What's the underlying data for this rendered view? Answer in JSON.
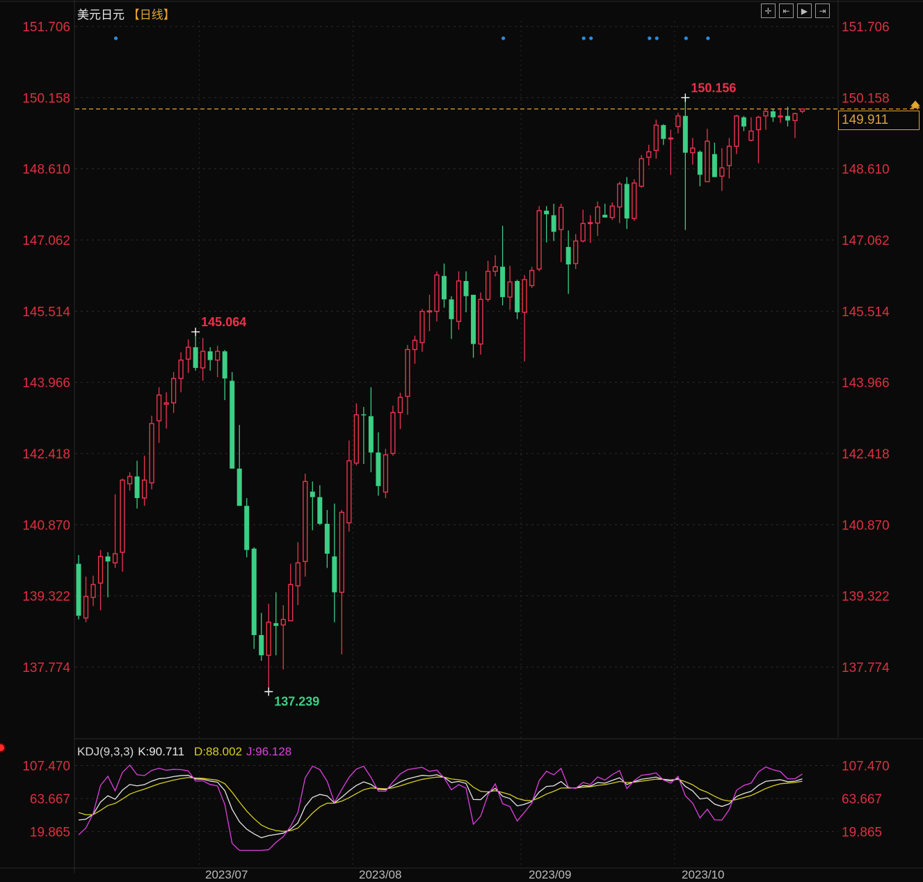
{
  "header": {
    "symbol": "美元日元",
    "period": "【日线】"
  },
  "toolbar": {
    "buttons": [
      {
        "name": "crosshair-button",
        "glyph": "✛"
      },
      {
        "name": "zoom-start-button",
        "glyph": "⇤"
      },
      {
        "name": "play-button",
        "glyph": "▶"
      },
      {
        "name": "jump-end-button",
        "glyph": "⇥"
      }
    ]
  },
  "current_price": "149.911",
  "indicator": {
    "name": "KDJ(9,3,3)",
    "k_label": "K:90.711",
    "d_label": "D:88.002",
    "j_label": "J:96.128"
  },
  "dates": [
    "2023/07",
    "2023/08",
    "2023/09",
    "2023/10"
  ],
  "colors": {
    "up": "#ee3550",
    "down": "#3ccf85",
    "axis_text": "#dd3040",
    "price_line": "#e6a532",
    "k": "#e8e8e8",
    "d": "#d8d020",
    "j": "#e040e0",
    "marker": "#2a8ae0"
  },
  "chart_data": {
    "type": "candlestick",
    "title": "美元日元 【日线】",
    "price_axis_labels": [
      "151.706",
      "150.158",
      "148.610",
      "147.062",
      "145.514",
      "143.966",
      "142.418",
      "140.870",
      "139.322",
      "137.774"
    ],
    "ylim": [
      136.9,
      151.706
    ],
    "high_label": "145.064",
    "high2_label": "150.156",
    "low_label": "137.239",
    "high_index": 16,
    "high2_index": 83,
    "low_index": 26,
    "last_price": 149.911,
    "event_marker_indices": [
      5,
      58,
      69,
      70,
      78,
      79,
      83,
      86
    ],
    "month_start_indices": [
      17,
      38,
      61,
      82
    ],
    "ohlc": [
      [
        140.02,
        140.21,
        138.81,
        138.89
      ],
      [
        138.84,
        139.74,
        138.75,
        139.31
      ],
      [
        139.29,
        139.76,
        139.1,
        139.57
      ],
      [
        139.6,
        140.32,
        139.01,
        140.18
      ],
      [
        140.18,
        140.27,
        139.29,
        140.07
      ],
      [
        140.04,
        141.53,
        139.93,
        140.24
      ],
      [
        140.27,
        141.87,
        139.85,
        141.84
      ],
      [
        141.76,
        142.01,
        141.61,
        141.92
      ],
      [
        141.92,
        142.26,
        141.22,
        141.45
      ],
      [
        141.45,
        142.37,
        141.28,
        141.84
      ],
      [
        141.78,
        143.24,
        141.64,
        143.07
      ],
      [
        143.13,
        143.86,
        142.65,
        143.69
      ],
      [
        143.49,
        143.75,
        142.96,
        143.52
      ],
      [
        143.52,
        144.19,
        143.3,
        144.05
      ],
      [
        144.05,
        144.62,
        143.75,
        144.45
      ],
      [
        144.47,
        144.9,
        144.17,
        144.73
      ],
      [
        144.73,
        145.064,
        144.22,
        144.28
      ],
      [
        144.28,
        144.93,
        144.0,
        144.64
      ],
      [
        144.64,
        144.73,
        144.22,
        144.45
      ],
      [
        144.45,
        144.76,
        144.08,
        144.64
      ],
      [
        144.64,
        144.67,
        143.58,
        144.05
      ],
      [
        144.0,
        144.19,
        142.09,
        142.09
      ],
      [
        142.09,
        143.04,
        141.28,
        141.28
      ],
      [
        141.28,
        141.45,
        140.16,
        140.32
      ],
      [
        140.35,
        140.38,
        138.17,
        138.47
      ],
      [
        138.47,
        138.95,
        137.91,
        138.03
      ],
      [
        138.03,
        139.15,
        137.239,
        138.75
      ],
      [
        138.73,
        139.4,
        138.03,
        138.67
      ],
      [
        138.69,
        139.12,
        137.72,
        138.81
      ],
      [
        138.78,
        140.02,
        138.78,
        139.57
      ],
      [
        139.54,
        140.49,
        139.12,
        140.04
      ],
      [
        140.07,
        141.98,
        139.74,
        141.81
      ],
      [
        141.59,
        141.81,
        140.75,
        141.47
      ],
      [
        141.47,
        141.73,
        140.86,
        140.89
      ],
      [
        140.89,
        141.19,
        139.93,
        140.24
      ],
      [
        140.18,
        141.33,
        138.75,
        139.4
      ],
      [
        139.4,
        141.19,
        138.05,
        141.14
      ],
      [
        140.91,
        142.7,
        140.72,
        142.26
      ],
      [
        142.21,
        143.51,
        142.16,
        143.26
      ],
      [
        143.27,
        143.43,
        142.19,
        143.25
      ],
      [
        143.23,
        143.86,
        142.01,
        142.44
      ],
      [
        142.44,
        142.88,
        141.5,
        141.71
      ],
      [
        141.58,
        142.52,
        141.45,
        142.39
      ],
      [
        142.42,
        143.46,
        142.37,
        143.31
      ],
      [
        143.31,
        143.74,
        142.95,
        143.64
      ],
      [
        143.66,
        144.78,
        143.26,
        144.68
      ],
      [
        144.68,
        144.98,
        144.37,
        144.88
      ],
      [
        144.83,
        145.56,
        144.63,
        145.51
      ],
      [
        145.5,
        145.87,
        145.08,
        145.52
      ],
      [
        145.51,
        146.38,
        145.29,
        146.3
      ],
      [
        146.28,
        146.55,
        145.59,
        145.77
      ],
      [
        145.77,
        145.84,
        144.91,
        145.34
      ],
      [
        145.29,
        146.38,
        145.11,
        146.17
      ],
      [
        146.17,
        146.38,
        145.49,
        145.84
      ],
      [
        145.87,
        145.87,
        144.5,
        144.8
      ],
      [
        144.8,
        145.92,
        144.57,
        145.77
      ],
      [
        145.77,
        146.61,
        145.72,
        146.38
      ],
      [
        146.38,
        146.73,
        146.27,
        146.48
      ],
      [
        146.48,
        147.37,
        145.64,
        145.82
      ],
      [
        145.82,
        146.5,
        145.54,
        146.15
      ],
      [
        146.17,
        146.2,
        145.34,
        145.49
      ],
      [
        145.49,
        146.3,
        144.42,
        146.2
      ],
      [
        146.07,
        146.48,
        146.02,
        146.4
      ],
      [
        146.43,
        147.8,
        146.38,
        147.7
      ],
      [
        147.7,
        147.8,
        147.01,
        147.62
      ],
      [
        147.6,
        147.85,
        147.04,
        147.24
      ],
      [
        147.29,
        147.85,
        146.58,
        147.77
      ],
      [
        146.91,
        147.27,
        145.89,
        146.53
      ],
      [
        146.55,
        147.19,
        146.43,
        147.04
      ],
      [
        147.04,
        147.72,
        147.01,
        147.42
      ],
      [
        147.42,
        147.6,
        147.0,
        147.44
      ],
      [
        147.43,
        147.9,
        147.15,
        147.78
      ],
      [
        147.61,
        147.85,
        147.55,
        147.55
      ],
      [
        147.55,
        147.88,
        147.5,
        147.8
      ],
      [
        147.78,
        148.33,
        147.43,
        148.28
      ],
      [
        148.28,
        148.43,
        147.3,
        147.53
      ],
      [
        147.53,
        148.38,
        147.48,
        148.3
      ],
      [
        148.23,
        148.91,
        148.2,
        148.83
      ],
      [
        148.86,
        149.13,
        148.68,
        148.98
      ],
      [
        149.01,
        149.68,
        148.83,
        149.56
      ],
      [
        149.56,
        149.58,
        149.13,
        149.26
      ],
      [
        149.27,
        149.46,
        148.48,
        149.28
      ],
      [
        149.53,
        149.83,
        149.38,
        149.76
      ],
      [
        149.76,
        150.156,
        147.28,
        148.96
      ],
      [
        148.96,
        149.28,
        148.7,
        149.06
      ],
      [
        148.98,
        149.01,
        148.23,
        148.48
      ],
      [
        148.33,
        149.48,
        148.33,
        149.21
      ],
      [
        148.93,
        149.18,
        148.43,
        148.43
      ],
      [
        148.45,
        149.06,
        148.13,
        148.63
      ],
      [
        148.68,
        149.28,
        148.4,
        149.1
      ],
      [
        149.1,
        149.78,
        148.93,
        149.76
      ],
      [
        149.73,
        149.76,
        149.43,
        149.53
      ],
      [
        149.23,
        149.73,
        149.21,
        149.43
      ],
      [
        149.46,
        149.76,
        148.73,
        149.73
      ],
      [
        149.76,
        149.91,
        149.46,
        149.86
      ],
      [
        149.86,
        149.91,
        149.63,
        149.73
      ],
      [
        149.75,
        149.93,
        149.61,
        149.76
      ],
      [
        149.76,
        149.96,
        149.53,
        149.66
      ],
      [
        149.66,
        149.83,
        149.28,
        149.81
      ],
      [
        149.86,
        149.92,
        149.82,
        149.911
      ]
    ],
    "kdj": {
      "params": [
        9,
        3,
        3
      ],
      "axis_labels": [
        "107.470",
        "63.667",
        "19.865"
      ],
      "last": {
        "K": 90.711,
        "D": 88.002,
        "J": 96.128
      }
    }
  }
}
